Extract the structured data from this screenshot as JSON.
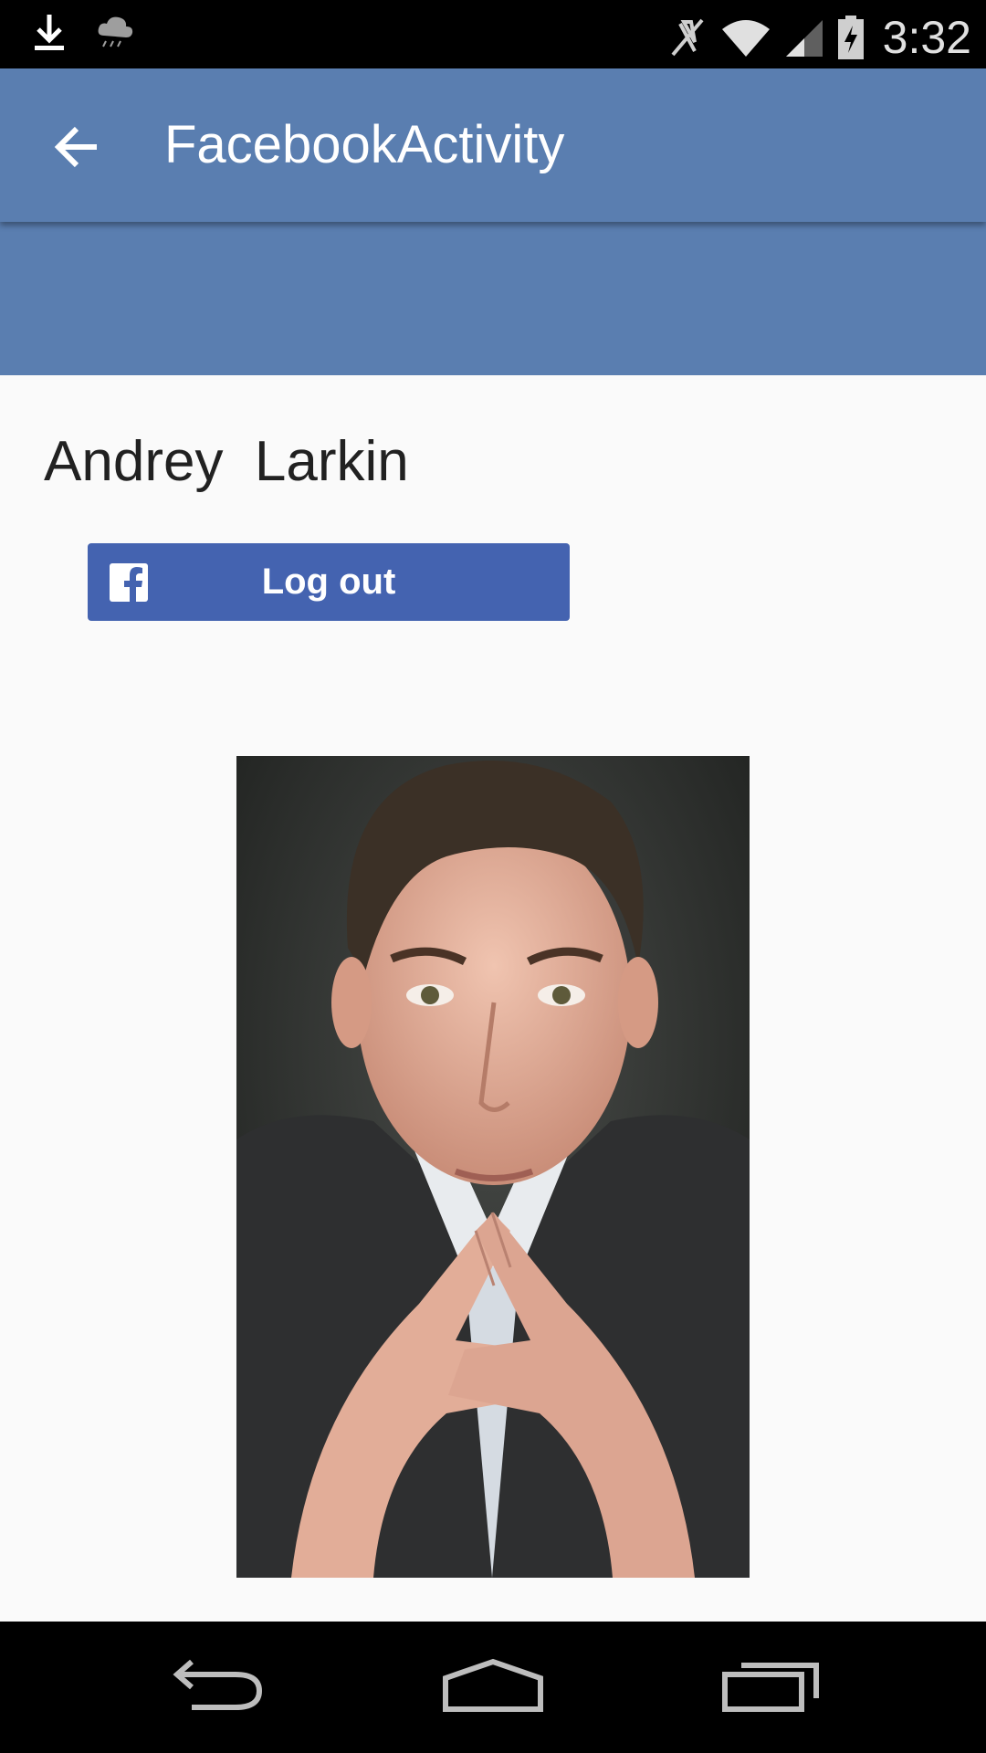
{
  "status_bar": {
    "time": "3:32",
    "left_icons": [
      "download-icon",
      "weather-cloud-icon"
    ],
    "right_icons": [
      "mute-icon",
      "wifi-icon",
      "signal-icon",
      "battery-charging-icon"
    ]
  },
  "app_bar": {
    "title": "FacebookActivity",
    "back_icon": "arrow-back-icon",
    "color": "#5a7eb0"
  },
  "profile": {
    "name": "Andrey  Larkin",
    "photo_alt": "profile-photo"
  },
  "logout_button": {
    "label": "Log out",
    "icon": "facebook-icon",
    "color": "#4463b0"
  },
  "nav_bar": {
    "items": [
      "back",
      "home",
      "recents"
    ]
  }
}
